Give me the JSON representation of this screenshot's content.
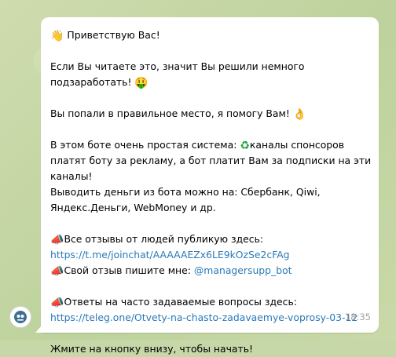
{
  "message": {
    "greeting": "Приветствую Вас!",
    "p1_l1": "Если Вы читаете это, значит Вы решили немного",
    "p1_l2": "подзаработать!",
    "p2": "Вы попали в правильное место, я помогу Вам!",
    "p3_l1a": "В этом боте очень простая система:",
    "p3_l1b": "каналы спонсоров",
    "p3_l2": "платят боту за рекламу, а бот платит Вам за подписки на эти",
    "p3_l3": "каналы!",
    "p3_l4": "Выводить деньги из бота можно на: Сбербанк, Qiwi,",
    "p3_l5": "Яндекс.Деньги, WebMoney и др.",
    "reviews_label": "Все отзывы от людей публикую здесь:",
    "reviews_link": "https://t.me/joinchat/AAAAAEZx6LE9kOzSe2cFAg",
    "your_review_label": "Свой отзыв пишите мне:",
    "your_review_user": "@managersupp_bot",
    "faq_label": "Ответы на часто задаваемые вопросы здесь:",
    "faq_link": "https://teleg.one/Otvety-na-chasto-zadavaemye-voprosy-03-12",
    "closing": "Жмите на кнопку внизу, чтобы начать!",
    "time": "18:35"
  },
  "emoji": {
    "wave": "👋",
    "money_face": "🤑",
    "ok_hand": "👌",
    "recycle": "♻",
    "megaphone": "📣"
  },
  "colors": {
    "background": "#c7d8a8",
    "bubble": "#ffffff",
    "link": "#2a7ab8",
    "time": "#a3a3a3"
  }
}
